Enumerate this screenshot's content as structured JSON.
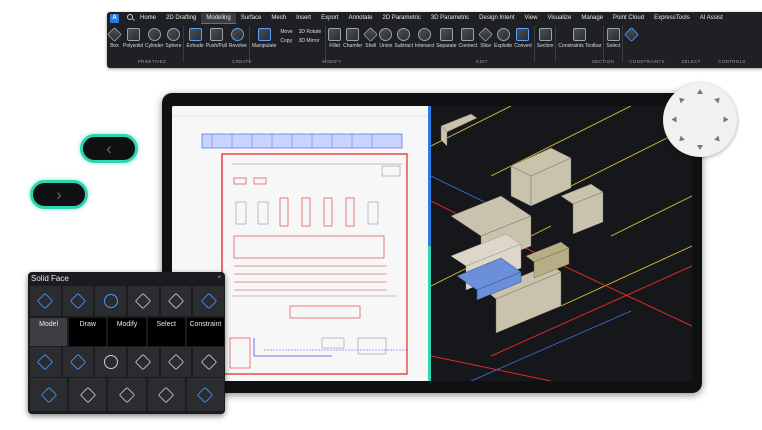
{
  "ribbon": {
    "app_button": "A",
    "tabs": [
      "Home",
      "2D Drafting",
      "Modeling",
      "Surface",
      "Mesh",
      "Insert",
      "Export",
      "Annotate",
      "2D Parametric",
      "3D Parametric",
      "Design Intent",
      "View",
      "Visualize",
      "Manage",
      "Point Cloud",
      "ExpressTools",
      "AI Assist"
    ],
    "active_tab": "Modeling",
    "tools": {
      "box": "Box",
      "polysolid": "Polysolid",
      "cylinder": "Cylinder",
      "sphere": "Sphere",
      "extrude": "Extrude",
      "pushpull": "Push/Pull",
      "revolve": "Revolve",
      "manipulate": "Manipulate",
      "move": "Move",
      "copy": "Copy",
      "rotate3d": "3D Rotate",
      "mirror3d": "3D Mirror",
      "fillet": "Fillet",
      "chamfer": "Chamfer",
      "shell": "Shell",
      "union": "Union",
      "subtract": "Subtract",
      "intersect": "Intersect",
      "separate": "Separate",
      "connect": "Connect",
      "slice": "Slice",
      "explode": "Explode",
      "convert": "Convert",
      "section": "Section",
      "constraints_toolbar": "Constraints Toolbar",
      "select": "Select"
    },
    "groups": [
      "PRIMITIVES",
      "CREATE",
      "MODIFY",
      "EDIT",
      "SECTION",
      "CONSTRAINTS",
      "SELECT",
      "CONTROLS"
    ]
  },
  "solid_face": {
    "title": "Solid Face",
    "close": "×",
    "tabs": [
      "Model",
      "Draw",
      "Modify",
      "Select",
      "Constraint"
    ],
    "active_tab": "Model"
  },
  "nav": {
    "prev": "‹",
    "next": "›"
  },
  "colors": {
    "accent": "#2b7be4",
    "teal": "#2ed6b0",
    "plan_red": "#e02a2a",
    "plan_blue": "#3a55e0"
  }
}
